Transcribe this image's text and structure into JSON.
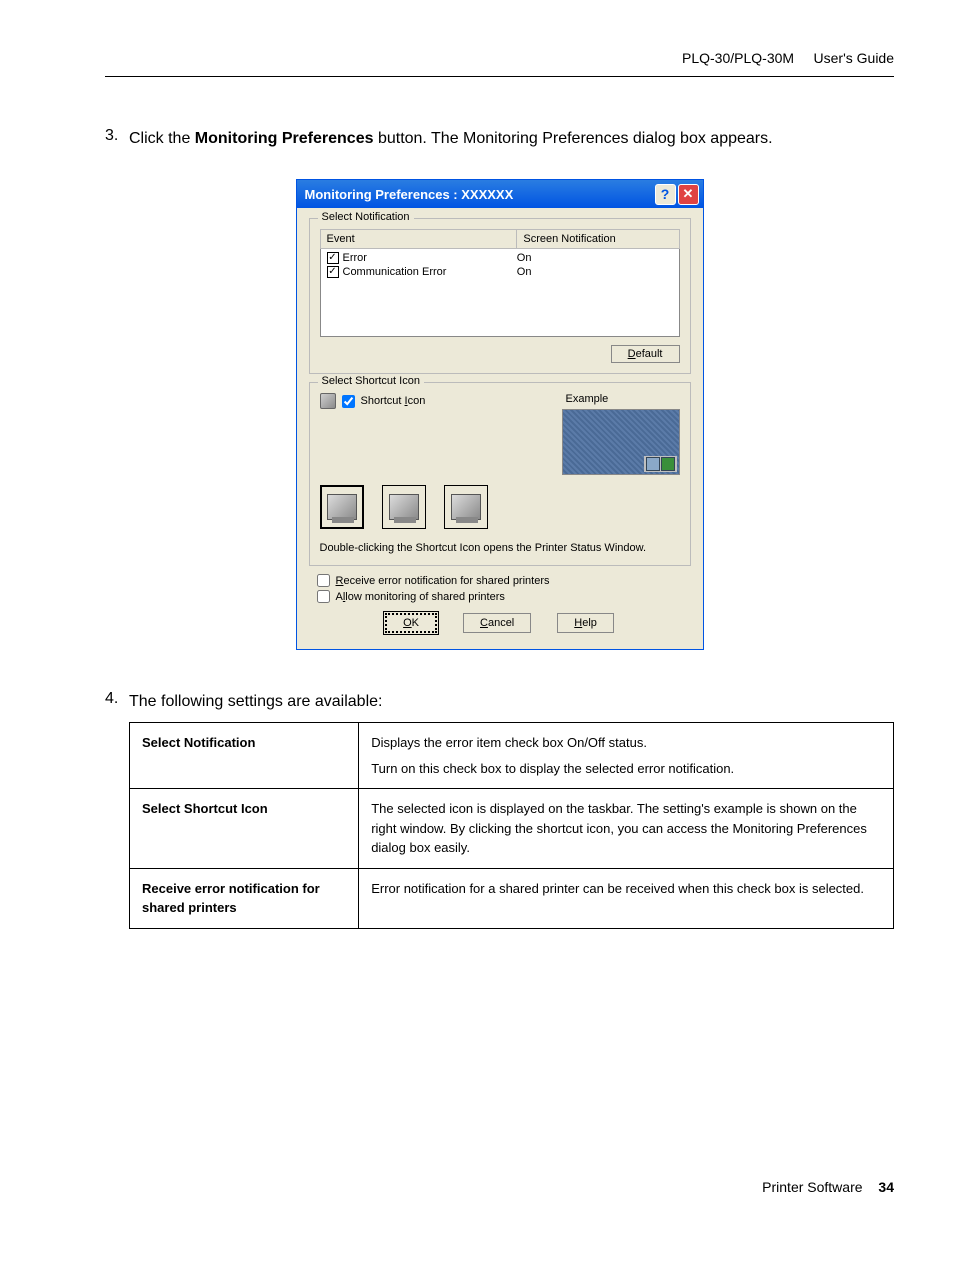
{
  "header": {
    "product": "PLQ-30/PLQ-30M",
    "guide": "User's Guide"
  },
  "step3": {
    "num": "3.",
    "prefix": "Click the ",
    "bold": "Monitoring Preferences",
    "suffix": " button. The Monitoring Preferences dialog box appears."
  },
  "dialog": {
    "title": "Monitoring Preferences : XXXXXX",
    "group_notification": "Select Notification",
    "col_event": "Event",
    "col_screen": "Screen Notification",
    "rows": [
      {
        "label": "Error",
        "value": "On"
      },
      {
        "label": "Communication Error",
        "value": "On"
      }
    ],
    "default_btn": "Default",
    "default_mnemonic": "D",
    "group_shortcut": "Select Shortcut Icon",
    "shortcut_chk": "Shortcut Icon",
    "shortcut_mnemonic": "I",
    "example": "Example",
    "hint": "Double-clicking the Shortcut Icon opens the Printer Status Window.",
    "chk_receive": "Receive error notification for shared printers",
    "chk_receive_mnemonic": "R",
    "chk_allow": "Allow monitoring of shared printers",
    "chk_allow_mnemonic": "l",
    "ok": "OK",
    "ok_mnemonic": "O",
    "cancel": "Cancel",
    "cancel_mnemonic": "C",
    "help": "Help",
    "help_mnemonic": "H"
  },
  "step4": {
    "num": "4.",
    "text": "The following settings are available:"
  },
  "table": {
    "r1_label": "Select Notification",
    "r1_line1": "Displays the error item check box On/Off status.",
    "r1_line2": "Turn on this check box to display the selected error notification.",
    "r2_label": "Select Shortcut Icon",
    "r2_text": "The selected icon is displayed on the taskbar. The setting's example is shown on the right window. By clicking the shortcut icon, you can access the Monitoring Preferences dialog box easily.",
    "r3_label": "Receive error notification for shared printers",
    "r3_text": "Error notification for a shared printer can be received when this check box is selected."
  },
  "footer": {
    "section": "Printer Software",
    "page": "34"
  }
}
